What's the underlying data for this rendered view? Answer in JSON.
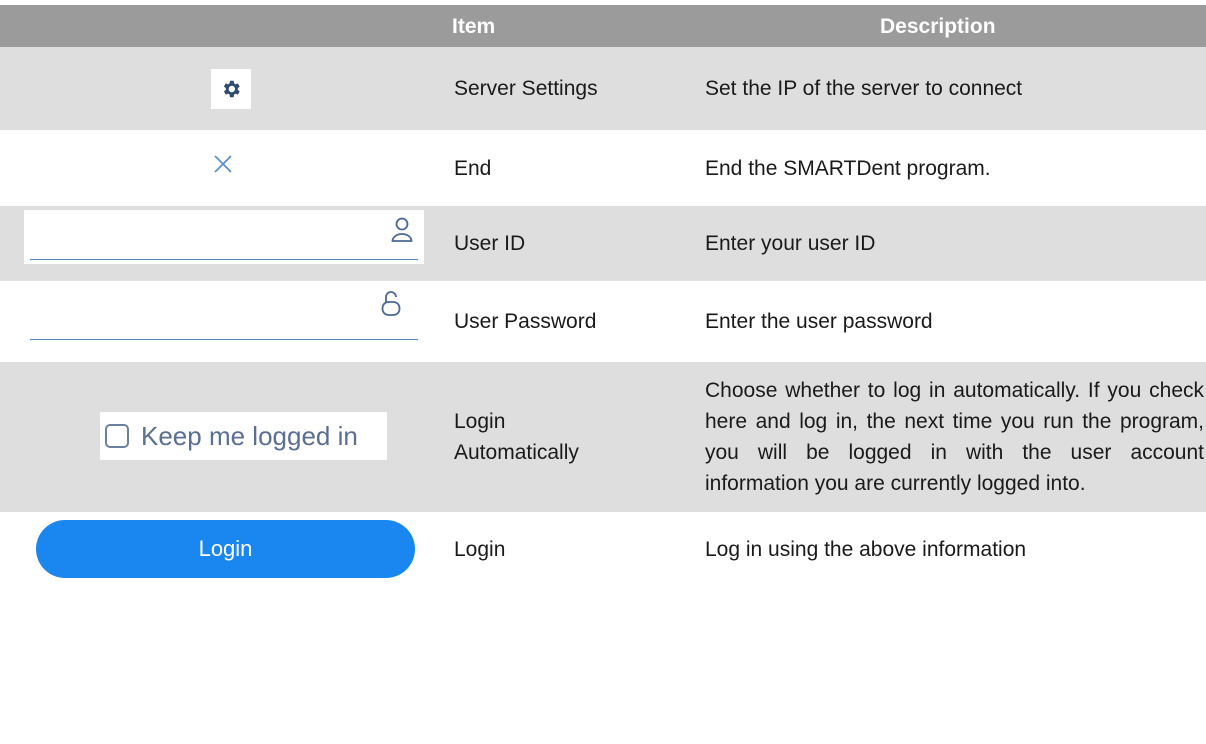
{
  "header": {
    "item": "Item",
    "description": "Description"
  },
  "rows": [
    {
      "icon": "gear-icon",
      "item": "Server Settings",
      "description": "Set the IP of the server to connect"
    },
    {
      "icon": "close-icon",
      "item": "End",
      "description": "End the SMARTDent program."
    },
    {
      "icon": "user-icon",
      "item": "User ID",
      "description": "Enter your user ID"
    },
    {
      "icon": "lock-icon",
      "item": "User Password",
      "description": "Enter the user password"
    },
    {
      "icon": "checkbox",
      "item_line1": "Login",
      "item_line2": "Automatically",
      "control_label": "Keep me logged in",
      "description": "Choose whether to log in automatically. If you check here and log in, the next time you run the program, you will be logged in with the user account information you are currently logged into."
    },
    {
      "icon": "login-button",
      "item": "Login",
      "control_label": "Login",
      "description": "Log in using the above information"
    }
  ],
  "colors": {
    "header_bg": "#9b9b9b",
    "row_gray": "#dedede",
    "accent_blue": "#1a86f0",
    "line_blue": "#4a86c8"
  }
}
